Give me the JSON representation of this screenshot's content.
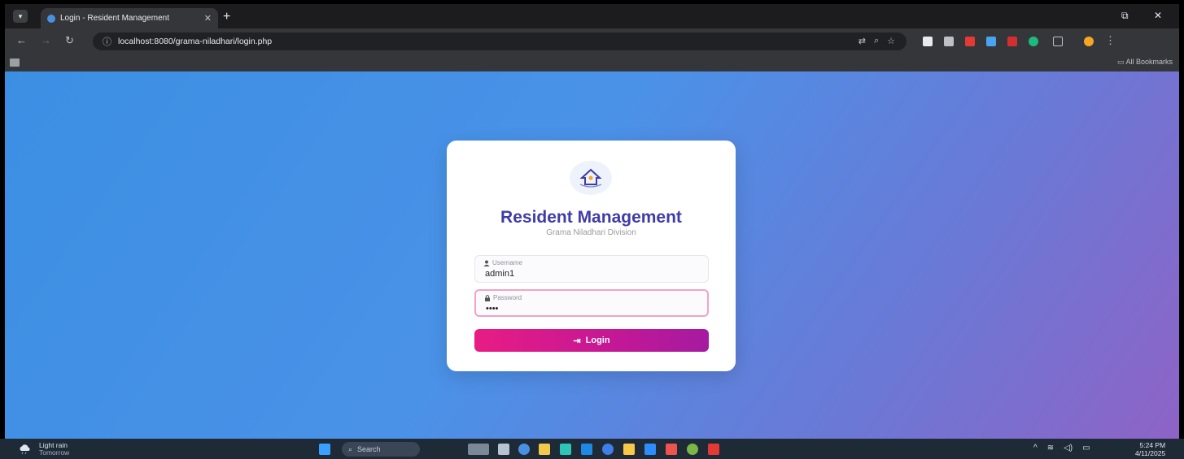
{
  "browser": {
    "tab_title": "Login - Resident Management",
    "tab_close": "✕",
    "new_tab": "+",
    "url": "localhost:8080/grama-niladhari/login.php",
    "bookmarks_label": "All Bookmarks",
    "window_controls": {
      "restore": "⧉",
      "close": "✕"
    }
  },
  "card": {
    "title": "Resident Management",
    "subtitle": "Grama Niladhari Division",
    "username": {
      "label": "Username",
      "value": "admin1"
    },
    "password": {
      "label": "Password",
      "value": "••••"
    },
    "login_label": "Login"
  },
  "taskbar": {
    "weather_title": "Light rain",
    "weather_sub": "Tomorrow",
    "search_label": "Search",
    "time": "5:24 PM",
    "date": "4/11/2025"
  },
  "colors": {
    "accent": "#3f3ca8",
    "button_start": "#e81c84",
    "button_end": "#a51aa0",
    "bg_start": "#3b8fe3",
    "bg_end": "#8e63c6"
  }
}
